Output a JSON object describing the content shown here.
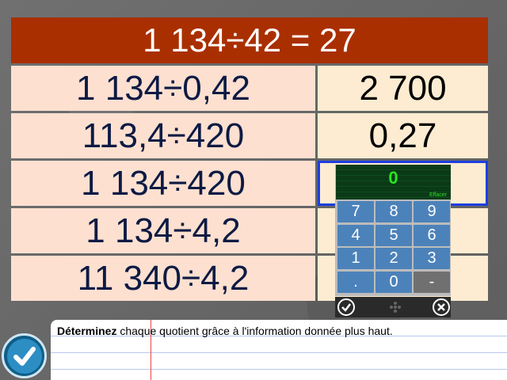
{
  "header": {
    "equation": "1 134÷42 = 27"
  },
  "rows": [
    {
      "question": "1 134÷0,42",
      "answer": "2 700"
    },
    {
      "question": "113,4÷420",
      "answer": "0,27"
    },
    {
      "question": "1 134÷420",
      "answer": ""
    },
    {
      "question": "1 134÷4,2",
      "answer": ""
    },
    {
      "question": "11 340÷4,2",
      "answer": ""
    }
  ],
  "keypad": {
    "display_value": "0",
    "erase_label": "Effacer",
    "keys": [
      "7",
      "8",
      "9",
      "4",
      "5",
      "6",
      "1",
      "2",
      "3",
      ".",
      "0",
      "-"
    ],
    "ok_icon": "check-circle-icon",
    "middle_icon": "move-icon",
    "cancel_icon": "close-circle-icon"
  },
  "instruction": {
    "bold": "Déterminez",
    "rest": " chaque quotient grâce à l'information donnée plus haut."
  },
  "colors": {
    "header_bg": "#a92f00",
    "left_cell": "#fde0d0",
    "right_cell": "#fdecd1",
    "active_border": "#1e3ee0",
    "key_bg": "#4c82ba",
    "display_text": "#29e61e"
  }
}
